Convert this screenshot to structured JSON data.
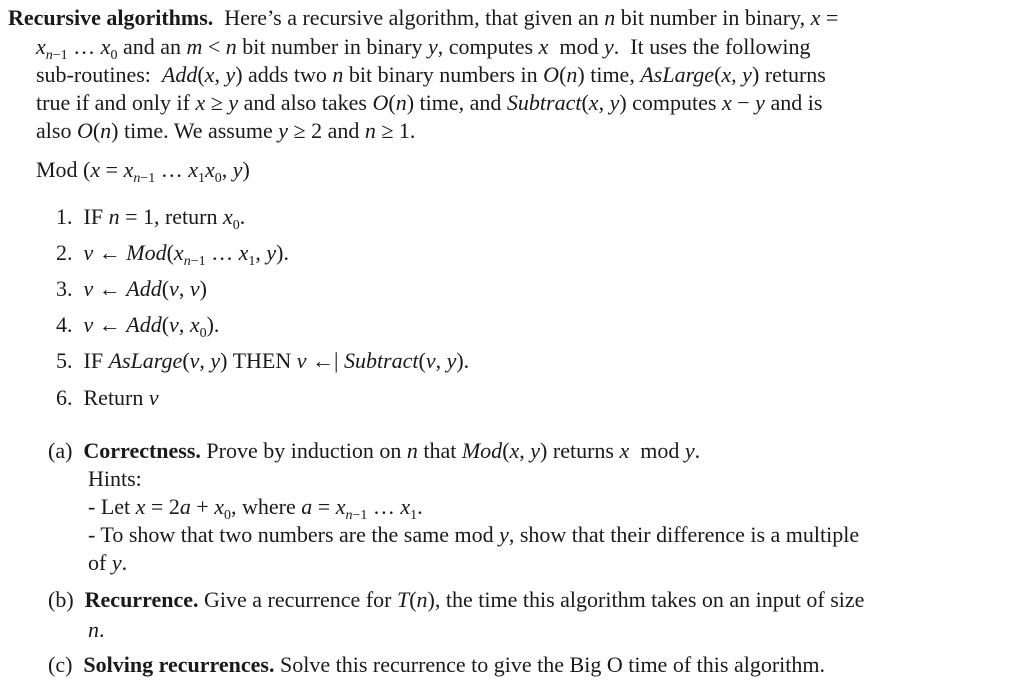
{
  "heading": "Recursive algorithms.",
  "intro": {
    "line1": "Here’s a recursive algorithm, that given an n bit number in binary, x =",
    "line2": "x_{n−1} … x_0 and an m < n bit number in binary y, computes x mod y. It uses the following",
    "line3": "sub-routines: Add(x, y) adds two n bit binary numbers in O(n) time, AsLarge(x, y) returns",
    "line4": "true if and only if x ≥ y and also takes O(n) time, and Subtract(x, y) computes x − y and is",
    "line5": "also O(n) time. We assume y ≥ 2 and n ≥ 1."
  },
  "signature": "Mod (x = x_{n−1} … x_1x_0, y)",
  "steps": [
    {
      "num": "1.",
      "text": "IF n = 1, return x_0."
    },
    {
      "num": "2.",
      "text": "v ← Mod(x_{n−1} … x_1, y)."
    },
    {
      "num": "3.",
      "text": "v ← Add(v, v)"
    },
    {
      "num": "4.",
      "text": "v ← Add(v, x_0)."
    },
    {
      "num": "5.",
      "text": "IF AsLarge(v, y) THEN v ←| Subtract(v, y)."
    },
    {
      "num": "6.",
      "text": "Return v"
    }
  ],
  "parts": [
    {
      "label": "(a)",
      "title": "Correctness.",
      "text": "Prove by induction on n that Mod(x, y) returns x mod y.",
      "hints_label": "Hints:",
      "hints": [
        "- Let x = 2a + x_0, where a = x_{n−1} … x_1.",
        "- To show that two numbers are the same mod y, show that their difference is a multiple of y."
      ]
    },
    {
      "label": "(b)",
      "title": "Recurrence.",
      "text": "Give a recurrence for T(n), the time this algorithm takes on an input of size n."
    },
    {
      "label": "(c)",
      "title": "Solving recurrences.",
      "text": "Solve this recurrence to give the Big O time of this algorithm."
    }
  ]
}
